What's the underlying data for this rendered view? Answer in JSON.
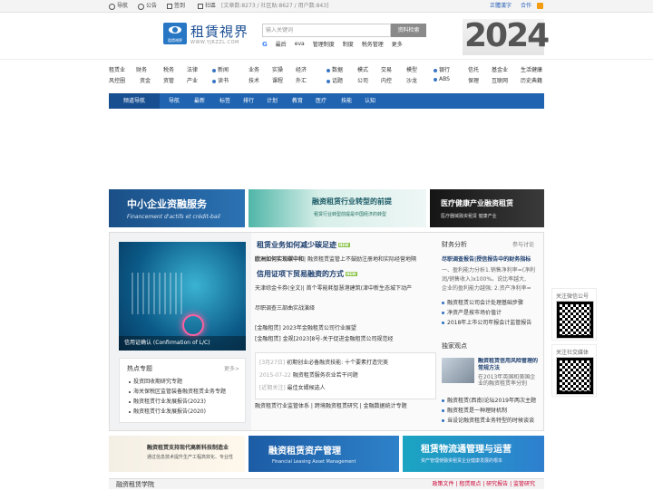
{
  "topbar": {
    "nav": "导航",
    "notice": "公告",
    "signin": "签到",
    "community": "社區",
    "stats": "[文章数:8273 / 社区贴:8627 / 用户数:843]",
    "simplified": "正體漢字",
    "cooperate": "合作"
  },
  "logo": {
    "title": "租賃視界",
    "small": "租賃視界",
    "url": "WWW.YJRZZL.COM"
  },
  "search": {
    "placeholder": "输入关键词",
    "button": "资料检索",
    "links": [
      "最后",
      "eva",
      "管理制度",
      "制度",
      "税务管理",
      "更多"
    ]
  },
  "banner": {
    "year": "2024"
  },
  "categories": {
    "row1": [
      "租赁业",
      "财务",
      "税务",
      "法律",
      "新闻",
      "业务",
      "实操",
      "经济",
      "数据",
      "模式",
      "交易",
      "模型",
      "银行",
      "信托",
      "基金业",
      "生活健康"
    ],
    "row2": [
      "风控圈",
      "资金",
      "资管",
      "产业",
      "读书",
      "技术",
      "课程",
      "外汇",
      "话题",
      "公司",
      "内控",
      "沙龙",
      "ABS",
      "保理",
      "互联网",
      "历史典籍"
    ]
  },
  "channel": {
    "lead": "频道导航",
    "items": [
      "导航",
      "最新",
      "标签",
      "排行",
      "计划",
      "教育",
      "医疗",
      "技能",
      "认知"
    ]
  },
  "ads_top": {
    "ad1_title": "中小企业资融服务",
    "ad1_sub": "Financement d'actifs et crédit-bail",
    "ad2_title": "融资租赁行业转型的前提",
    "ad2_sub": "租赁行业转型前提是中国经济的转型",
    "ad3_title": "医疗健康产业融资租赁",
    "ad3_sub": "医疗器械融资租赁 健康产业"
  },
  "feature": {
    "caption": "信用证确认 (Confirmation of L/C)",
    "hot_title": "热点专题",
    "hot_more": "更多>",
    "hot_items": [
      "投资回收期研究专题",
      "海关保税区监管装备融资租赁业务专题",
      "融资租赁行业发展报告(2023)",
      "融资租赁行业发展报告(2020)"
    ]
  },
  "center": {
    "h1": "租赁业务如何减少碳足迹",
    "h1_tag": "NEW",
    "l1": "欧洲如何实现碳中和",
    "l1_rest": "| 融资租赁监管上不鼓励注册地和实际经营地隔",
    "h2": "信用证项下贸易融资的方式",
    "h2_tag": "NEW",
    "l2": "天津综金卡券(全文)",
    "l2_rest": "| 首个零能耗智慧港建筑(津中新生态城下动产",
    "l3": "尽职调查三部曲实战演绎",
    "b1": "[金融租赁] 2023年金融租赁公司行业展望",
    "b2": "[金融租赁] 金规[2023]8号-关于促进金融租赁公司规范经",
    "d1": "[3月27日]",
    "d1_text": "初期创业必备融资技能: 十个要素打造完美",
    "d2": "2015-07-22",
    "d2_text": "融资租赁服务农业若干问题",
    "d3": "[近期关注]",
    "d3_text": "最佳女婿候选人",
    "bottom": "融资租赁行业监管体系 | 跨境融资租赁研究 | 金融数据统计专题"
  },
  "right": {
    "sec1": "财务分析",
    "sec1_link": "参与讨论",
    "r_title": "尽职调查报告|授信报告中的财务指标",
    "r1": "一、盈利能力分析1.销售净利率=(净利",
    "r2": "润/销售收入)x100%。说比率越大,",
    "r3": "企业的盈利能力越强; 2.资产净利率=",
    "r4": "融资租赁公司会计处理基础步骤",
    "r5": "净资产是按市场价值计",
    "r6": "2018年上市公司年报会计监管报告",
    "sec2": "独家观点",
    "t_title": "融资租赁信用风险管理的常规方法",
    "t_text": "在2013年英国和美国企业的融资租赁率分别",
    "r7": "融资租赁(西南)论坛2019年两次主题",
    "r8": "融资租赁是一种理财机制",
    "r9": "当设论融资租赁业务特型的时候谈谈"
  },
  "qr": {
    "wx": "关注微信公号",
    "wb": "关注社交媒体"
  },
  "ads_bottom": {
    "b1_title": "融资租赁支持现代高新科技制造业",
    "b1_sub": "通过信息技术提升生产工程高效化、专业性",
    "b2_title": "融资租赁资产管理",
    "b2_sub": "Financial Leasing Asset Management",
    "b3_title": "租赁物流通管理与运营",
    "b3_sub": "资产管理使融资租赁企业健康发展的根本"
  },
  "academy": {
    "title": "融资租赁学院",
    "links": "政策文件 | 租赁观点 | 研究报告 | 监管研究"
  }
}
